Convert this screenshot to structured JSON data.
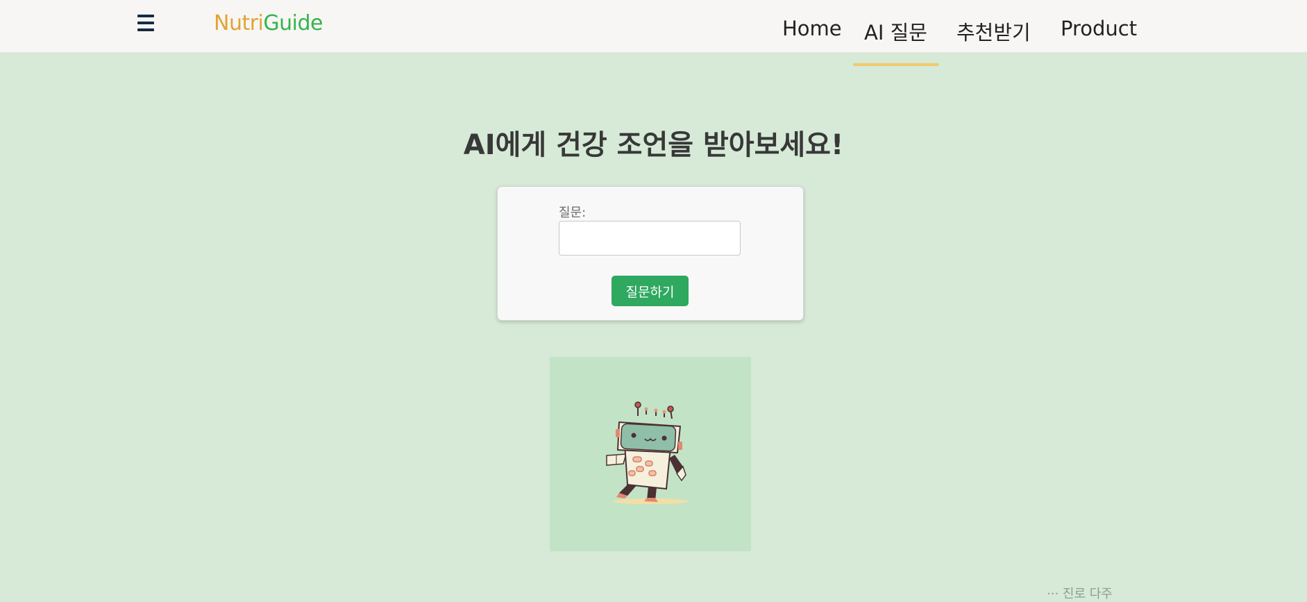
{
  "header": {
    "logo_part1": "Nutri",
    "logo_part2": "Guide",
    "nav": [
      {
        "label": "Home"
      },
      {
        "label": "AI 질문",
        "active": true
      },
      {
        "label": "추천받기"
      },
      {
        "label": "Product"
      }
    ],
    "menu_icon": "hamburger-menu-icon"
  },
  "main": {
    "title": "AI에게 건강 조언을 받아보세요!",
    "question_label": "질문:",
    "question_value": "",
    "submit_label": "질문하기",
    "illustration": "robot-illustration"
  },
  "footer": {
    "partial_text": "··· 진로 다주"
  },
  "colors": {
    "background": "#d6ead7",
    "header": "#f7f6f4",
    "logo_nutri": "#e0a432",
    "logo_guide": "#35b34e",
    "active_underline": "#f2c96d",
    "button": "#2fa860"
  }
}
